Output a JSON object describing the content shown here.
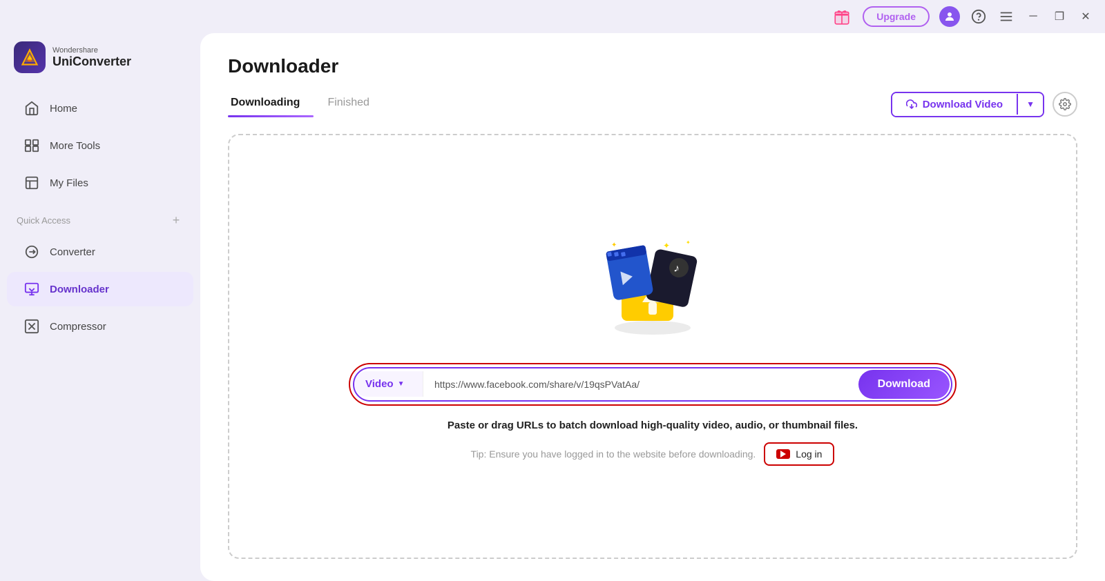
{
  "app": {
    "brand": "Wondershare",
    "product": "UniConverter"
  },
  "titlebar": {
    "upgrade_label": "Upgrade",
    "minimize_label": "─",
    "maximize_label": "❐",
    "close_label": "✕"
  },
  "sidebar": {
    "nav_items": [
      {
        "id": "home",
        "label": "Home",
        "active": false
      },
      {
        "id": "more-tools",
        "label": "More Tools",
        "active": false
      },
      {
        "id": "my-files",
        "label": "My Files",
        "active": false
      }
    ],
    "quick_access_label": "Quick Access",
    "quick_access_items": [
      {
        "id": "converter",
        "label": "Converter",
        "active": false
      },
      {
        "id": "downloader",
        "label": "Downloader",
        "active": true
      },
      {
        "id": "compressor",
        "label": "Compressor",
        "active": false
      }
    ]
  },
  "main": {
    "page_title": "Downloader",
    "tabs": [
      {
        "id": "downloading",
        "label": "Downloading",
        "active": true
      },
      {
        "id": "finished",
        "label": "Finished",
        "active": false
      }
    ],
    "download_video_btn_label": "Download Video",
    "content": {
      "url_placeholder": "https://www.facebook.com/share/v/19qsPVatAa/",
      "type_label": "Video",
      "download_btn_label": "Download",
      "paste_hint": "Paste or drag URLs to batch download high-quality video, audio, or thumbnail files.",
      "tip_text": "Tip: Ensure you have logged in to the website before downloading.",
      "login_label": "Log in"
    }
  }
}
